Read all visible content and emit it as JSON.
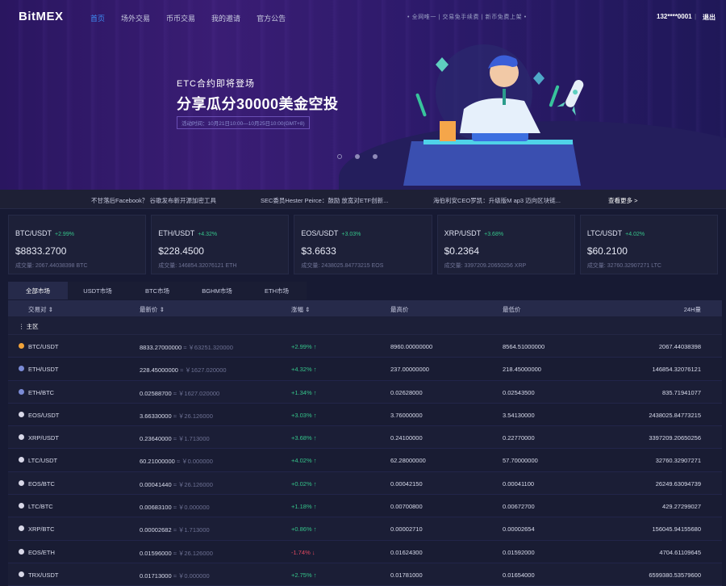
{
  "header": {
    "logo": "BitMEX",
    "nav": [
      "首页",
      "场外交易",
      "币币交易",
      "我的邀请",
      "官方公告"
    ],
    "notice": "• 全网唯一  |  交易免手续费  |  新币免费上架 •",
    "user": "132****0001",
    "separator": "|",
    "logout": "退出"
  },
  "banner": {
    "subtitle": "ETC合约即将登场",
    "title": "分享瓜分30000美金空投",
    "time": "活动时间：10月21日10:00—10月25日10:00(GMT+8)"
  },
  "ticker": {
    "items": [
      "不甘落后Facebook？ 谷歌发布新开源加密工具",
      "SEC委员Hester Peirce：鼓励 放宽对ETF创新...",
      "海伯利安CEO罗凯：升级版M ap3 迈向区块链..."
    ],
    "more": "查看更多 >"
  },
  "cards": [
    {
      "pair": "BTC/USDT",
      "change": "+2.99%",
      "price": "$8833.2700",
      "volume": "成交量: 2067.44038398 BTC"
    },
    {
      "pair": "ETH/USDT",
      "change": "+4.32%",
      "price": "$228.4500",
      "volume": "成交量: 146854.32076121 ETH"
    },
    {
      "pair": "EOS/USDT",
      "change": "+3.03%",
      "price": "$3.6633",
      "volume": "成交量: 2438025.84773215 EOS"
    },
    {
      "pair": "XRP/USDT",
      "change": "+3.68%",
      "price": "$0.2364",
      "volume": "成交量: 3397209.20650256 XRP"
    },
    {
      "pair": "LTC/USDT",
      "change": "+4.02%",
      "price": "$60.2100",
      "volume": "成交量: 32760.32907271 LTC"
    }
  ],
  "tabs": [
    "全部市场",
    "USDT市场",
    "BTC市场",
    "BGHM市场",
    "ETH市场"
  ],
  "table": {
    "headers": {
      "pair": "交易对 ⇕",
      "latest": "最新价 ⇕",
      "change": "涨幅 ⇕",
      "high": "最高价",
      "low": "最低价",
      "volume": "24H量"
    },
    "section": "⋮ 主区",
    "rows": [
      {
        "pair": "BTC/USDT",
        "price": "8833.27000000",
        "cny": "≈ ￥63251.320000",
        "change": "+2.99% ↑",
        "high": "8960.00000000",
        "low": "8564.51000000",
        "volume": "2067.44038398",
        "icon_color": "#f2a33a",
        "dir": "up"
      },
      {
        "pair": "ETH/USDT",
        "price": "228.45000000",
        "cny": "≈ ￥1627.020000",
        "change": "+4.32% ↑",
        "high": "237.00000000",
        "low": "218.45000000",
        "volume": "146854.32076121",
        "icon_color": "#7b8bd6",
        "dir": "up"
      },
      {
        "pair": "ETH/BTC",
        "price": "0.02588700",
        "cny": "≈ ￥1627.020000",
        "change": "+1.34% ↑",
        "high": "0.02628000",
        "low": "0.02543500",
        "volume": "835.71941077",
        "icon_color": "#7b8bd6",
        "dir": "up"
      },
      {
        "pair": "EOS/USDT",
        "price": "3.66330000",
        "cny": "≈ ￥26.126000",
        "change": "+3.03% ↑",
        "high": "3.76000000",
        "low": "3.54130000",
        "volume": "2438025.84773215",
        "icon_color": "#d8d8e8",
        "dir": "up"
      },
      {
        "pair": "XRP/USDT",
        "price": "0.23640000",
        "cny": "≈ ￥1.713000",
        "change": "+3.68% ↑",
        "high": "0.24100000",
        "low": "0.22770000",
        "volume": "3397209.20650256",
        "icon_color": "#d8d8e8",
        "dir": "up"
      },
      {
        "pair": "LTC/USDT",
        "price": "60.21000000",
        "cny": "≈ ￥0.000000",
        "change": "+4.02% ↑",
        "high": "62.28000000",
        "low": "57.70000000",
        "volume": "32760.32907271",
        "icon_color": "#d8d8e8",
        "dir": "up"
      },
      {
        "pair": "EOS/BTC",
        "price": "0.00041440",
        "cny": "≈ ￥26.126000",
        "change": "+0.02% ↑",
        "high": "0.00042150",
        "low": "0.00041100",
        "volume": "26249.63094739",
        "icon_color": "#d8d8e8",
        "dir": "up"
      },
      {
        "pair": "LTC/BTC",
        "price": "0.00683100",
        "cny": "≈ ￥0.000000",
        "change": "+1.18% ↑",
        "high": "0.00700800",
        "low": "0.00672700",
        "volume": "429.27299027",
        "icon_color": "#d8d8e8",
        "dir": "up"
      },
      {
        "pair": "XRP/BTC",
        "price": "0.00002682",
        "cny": "≈ ￥1.713000",
        "change": "+0.86% ↑",
        "high": "0.00002710",
        "low": "0.00002654",
        "volume": "156045.94155680",
        "icon_color": "#d8d8e8",
        "dir": "up"
      },
      {
        "pair": "EOS/ETH",
        "price": "0.01596000",
        "cny": "≈ ￥26.126000",
        "change": "-1.74% ↓",
        "high": "0.01624300",
        "low": "0.01592000",
        "volume": "4704.61109645",
        "icon_color": "#d8d8e8",
        "dir": "down"
      },
      {
        "pair": "TRX/USDT",
        "price": "0.01713000",
        "cny": "≈ ￥0.000000",
        "change": "+2.75% ↑",
        "high": "0.01781000",
        "low": "0.01654000",
        "volume": "6599380.53579600",
        "icon_color": "#d8d8e8",
        "dir": "up"
      }
    ]
  },
  "colors": {
    "up": "#35c48a",
    "down": "#e0485f",
    "accent": "#3d8df5"
  }
}
